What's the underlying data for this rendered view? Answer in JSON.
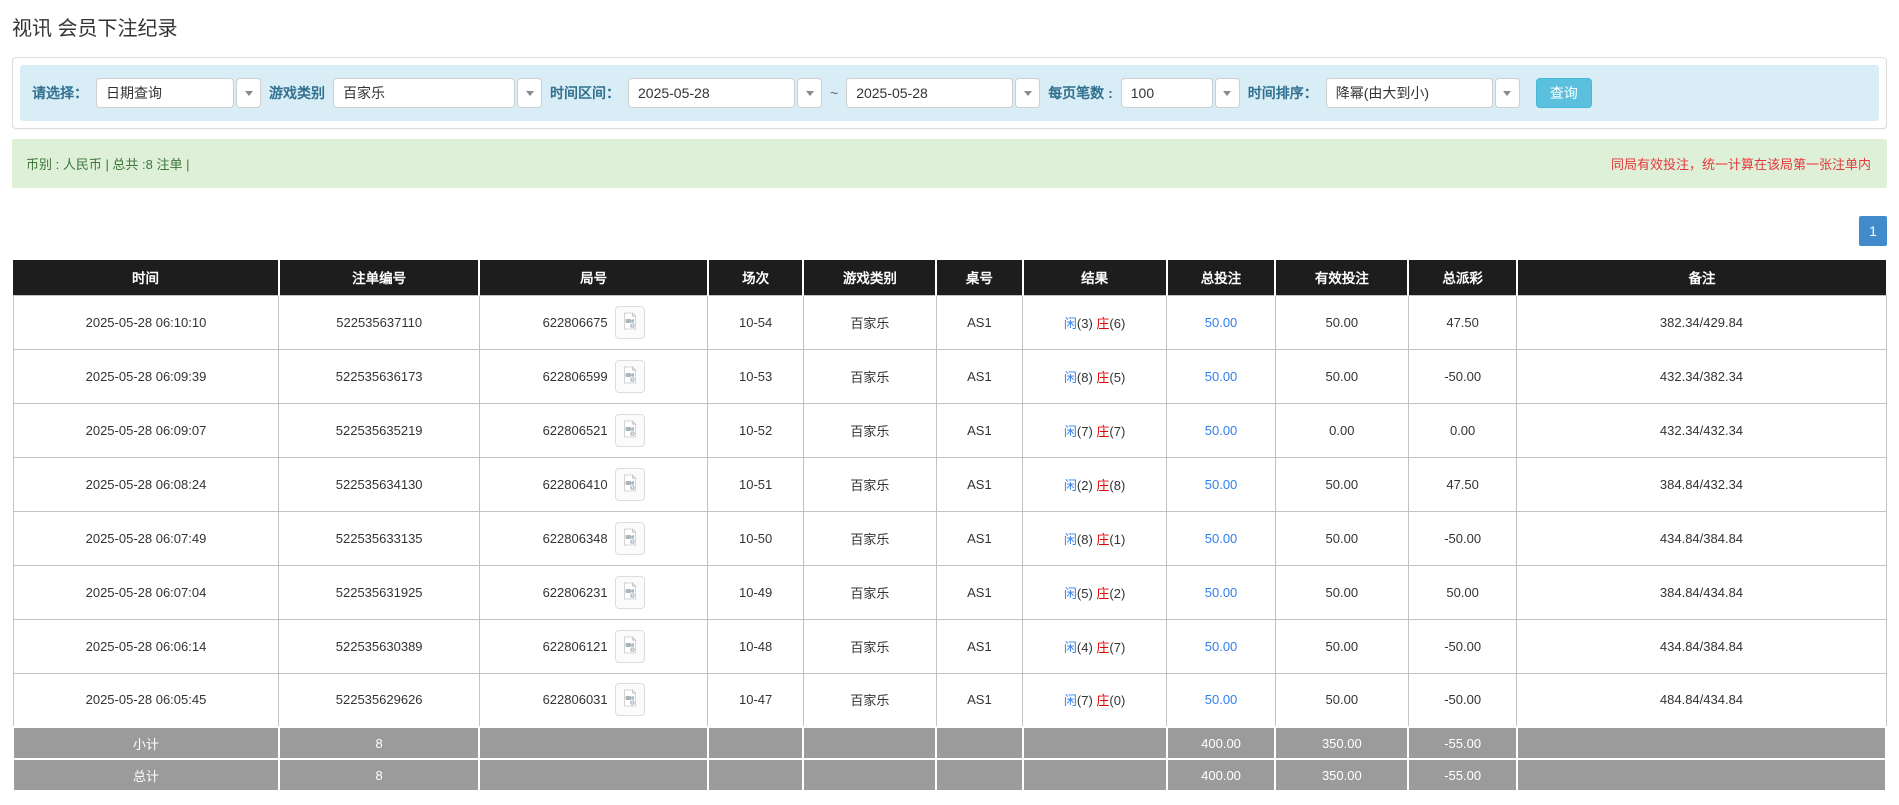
{
  "page": {
    "title": "视讯 会员下注纪录"
  },
  "filters": {
    "select_label": "请选择：",
    "select_value": "日期查询",
    "game_type_label": "游戏类别",
    "game_type_value": "百家乐",
    "time_range_label": "时间区间：",
    "date_from": "2025-05-28",
    "date_to": "2025-05-28",
    "tilde": "~",
    "per_page_label": "每页笔数 :",
    "per_page_value": "100",
    "sort_label": "时间排序：",
    "sort_value": "降幂(由大到小)",
    "search_button": "查询"
  },
  "summary": {
    "left": "币别 : 人民币 | 总共 :8 注单 |",
    "right_notice": "同局有效投注，统一计算在该局第一张注单内"
  },
  "pagination": {
    "current": "1"
  },
  "colors": {
    "accent_blue": "#2f80ed",
    "danger_red": "#e60000",
    "header_bg": "#1d1d1d",
    "footer_bg": "#9b9b9b",
    "info_bar_bg": "#d9edf7",
    "success_bar_bg": "#dff0d8",
    "search_button_bg": "#5bc0de",
    "pagination_bg": "#428bca"
  },
  "icons": {
    "combo_arrow": "chevron-down-icon",
    "round_video": "video-replay-icon"
  },
  "table": {
    "headers": [
      "时间",
      "注单编号",
      "局号",
      "场次",
      "游戏类别",
      "桌号",
      "结果",
      "总投注",
      "有效投注",
      "总派彩",
      "备注"
    ],
    "rows": [
      {
        "time": "2025-05-28 06:10:10",
        "order_no": "522535637110",
        "round_no": "622806675",
        "session": "10-54",
        "game_type": "百家乐",
        "table_no": "AS1",
        "result": {
          "player_label": "闲",
          "player_score": "(3)",
          "banker_label": "庄",
          "banker_score": "(6)"
        },
        "total_bet": "50.00",
        "valid_bet": "50.00",
        "payout": "47.50",
        "remark": "382.34/429.84"
      },
      {
        "time": "2025-05-28 06:09:39",
        "order_no": "522535636173",
        "round_no": "622806599",
        "session": "10-53",
        "game_type": "百家乐",
        "table_no": "AS1",
        "result": {
          "player_label": "闲",
          "player_score": "(8)",
          "banker_label": "庄",
          "banker_score": "(5)"
        },
        "total_bet": "50.00",
        "valid_bet": "50.00",
        "payout": "-50.00",
        "remark": "432.34/382.34"
      },
      {
        "time": "2025-05-28 06:09:07",
        "order_no": "522535635219",
        "round_no": "622806521",
        "session": "10-52",
        "game_type": "百家乐",
        "table_no": "AS1",
        "result": {
          "player_label": "闲",
          "player_score": "(7)",
          "banker_label": "庄",
          "banker_score": "(7)"
        },
        "total_bet": "50.00",
        "valid_bet": "0.00",
        "payout": "0.00",
        "remark": "432.34/432.34"
      },
      {
        "time": "2025-05-28 06:08:24",
        "order_no": "522535634130",
        "round_no": "622806410",
        "session": "10-51",
        "game_type": "百家乐",
        "table_no": "AS1",
        "result": {
          "player_label": "闲",
          "player_score": "(2)",
          "banker_label": "庄",
          "banker_score": "(8)"
        },
        "total_bet": "50.00",
        "valid_bet": "50.00",
        "payout": "47.50",
        "remark": "384.84/432.34"
      },
      {
        "time": "2025-05-28 06:07:49",
        "order_no": "522535633135",
        "round_no": "622806348",
        "session": "10-50",
        "game_type": "百家乐",
        "table_no": "AS1",
        "result": {
          "player_label": "闲",
          "player_score": "(8)",
          "banker_label": "庄",
          "banker_score": "(1)"
        },
        "total_bet": "50.00",
        "valid_bet": "50.00",
        "payout": "-50.00",
        "remark": "434.84/384.84"
      },
      {
        "time": "2025-05-28 06:07:04",
        "order_no": "522535631925",
        "round_no": "622806231",
        "session": "10-49",
        "game_type": "百家乐",
        "table_no": "AS1",
        "result": {
          "player_label": "闲",
          "player_score": "(5)",
          "banker_label": "庄",
          "banker_score": "(2)"
        },
        "total_bet": "50.00",
        "valid_bet": "50.00",
        "payout": "50.00",
        "remark": "384.84/434.84"
      },
      {
        "time": "2025-05-28 06:06:14",
        "order_no": "522535630389",
        "round_no": "622806121",
        "session": "10-48",
        "game_type": "百家乐",
        "table_no": "AS1",
        "result": {
          "player_label": "闲",
          "player_score": "(4)",
          "banker_label": "庄",
          "banker_score": "(7)"
        },
        "total_bet": "50.00",
        "valid_bet": "50.00",
        "payout": "-50.00",
        "remark": "434.84/384.84"
      },
      {
        "time": "2025-05-28 06:05:45",
        "order_no": "522535629626",
        "round_no": "622806031",
        "session": "10-47",
        "game_type": "百家乐",
        "table_no": "AS1",
        "result": {
          "player_label": "闲",
          "player_score": "(7)",
          "banker_label": "庄",
          "banker_score": "(0)"
        },
        "total_bet": "50.00",
        "valid_bet": "50.00",
        "payout": "-50.00",
        "remark": "484.84/434.84"
      }
    ],
    "footer_rows": [
      {
        "label": "小计",
        "count": "8",
        "total_bet": "400.00",
        "valid_bet": "350.00",
        "payout": "-55.00"
      },
      {
        "label": "总计",
        "count": "8",
        "total_bet": "400.00",
        "valid_bet": "350.00",
        "payout": "-55.00"
      }
    ]
  }
}
